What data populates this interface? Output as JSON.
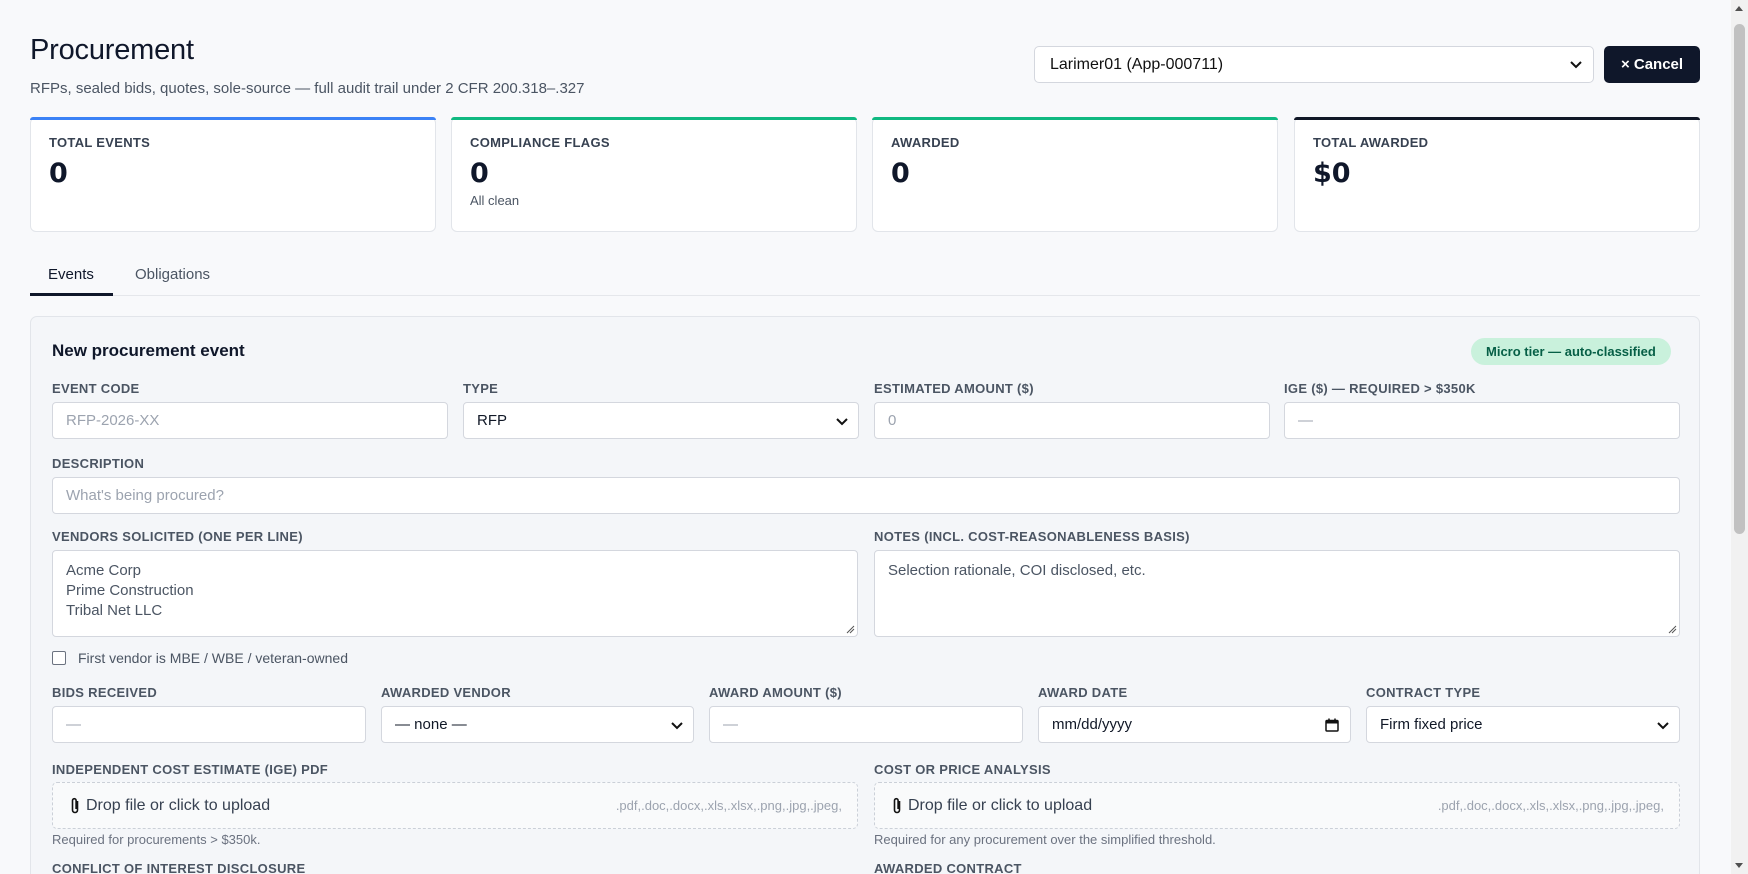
{
  "header": {
    "title": "Procurement",
    "subtitle": "RFPs, sealed bids, quotes, sole-source — full audit trail under 2 CFR 200.318–.327",
    "app_select_value": "Larimer01 (App-000711)",
    "cancel_label": "× Cancel"
  },
  "stats": [
    {
      "label": "TOTAL EVENTS",
      "value": "0",
      "note": "",
      "accent": "#3b82f6"
    },
    {
      "label": "COMPLIANCE FLAGS",
      "value": "0",
      "note": "All clean",
      "accent": "#10b981"
    },
    {
      "label": "AWARDED",
      "value": "0",
      "note": "",
      "accent": "#10b981"
    },
    {
      "label": "TOTAL AWARDED",
      "value": "$0",
      "note": "",
      "accent": "#111827"
    }
  ],
  "tabs": [
    {
      "label": "Events",
      "active": true
    },
    {
      "label": "Obligations",
      "active": false
    }
  ],
  "form": {
    "title": "New procurement event",
    "tier_badge": "Micro tier — auto-classified",
    "event_code": {
      "label": "EVENT CODE",
      "placeholder": "RFP-2026-XX"
    },
    "type": {
      "label": "TYPE",
      "value": "RFP"
    },
    "estimated_amount": {
      "label": "ESTIMATED AMOUNT ($)",
      "placeholder": "0"
    },
    "ige": {
      "label": "IGE ($) — REQUIRED > $350K",
      "placeholder": "—"
    },
    "description": {
      "label": "DESCRIPTION",
      "placeholder": "What's being procured?"
    },
    "vendors": {
      "label": "VENDORS SOLICITED (ONE PER LINE)",
      "lines": [
        "Acme Corp",
        "Prime Construction",
        "Tribal Net LLC"
      ]
    },
    "notes": {
      "label": "NOTES (INCL. COST-REASONABLENESS BASIS)",
      "placeholder": "Selection rationale, COI disclosed, etc."
    },
    "mbe_checkbox_label": "First vendor is MBE / WBE / veteran-owned",
    "bids_received": {
      "label": "BIDS RECEIVED",
      "placeholder": "—"
    },
    "awarded_vendor": {
      "label": "AWARDED VENDOR",
      "value": "— none —"
    },
    "award_amount": {
      "label": "AWARD AMOUNT ($)",
      "placeholder": "—"
    },
    "award_date": {
      "label": "AWARD DATE",
      "placeholder": "mm/dd/yyyy"
    },
    "contract_type": {
      "label": "CONTRACT TYPE",
      "value": "Firm fixed price"
    },
    "ige_pdf": {
      "label": "INDEPENDENT COST ESTIMATE (IGE) PDF",
      "upload_label": "Drop file or click to upload",
      "file_types": ".pdf,.doc,.docx,.xls,.xlsx,.png,.jpg,.jpeg,",
      "hint": "Required for procurements > $350k."
    },
    "cost_analysis": {
      "label": "COST OR PRICE ANALYSIS",
      "upload_label": "Drop file or click to upload",
      "file_types": ".pdf,.doc,.docx,.xls,.xlsx,.png,.jpg,.jpeg,",
      "hint": "Required for any procurement over the simplified threshold."
    },
    "coi_label": "CONFLICT OF INTEREST DISCLOSURE",
    "awarded_contract_label": "AWARDED CONTRACT"
  },
  "icons": {
    "chevron": "chevron-down-icon",
    "paperclip": "paperclip-icon",
    "calendar": "calendar-icon"
  }
}
